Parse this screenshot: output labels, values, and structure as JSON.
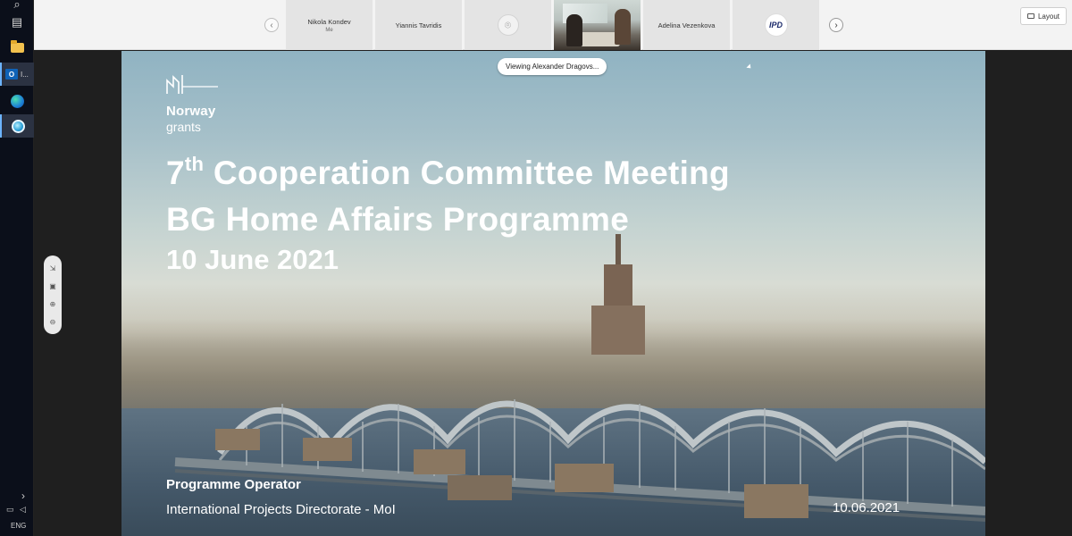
{
  "taskbar": {
    "language": "ENG",
    "outlook_badge": "I...",
    "show_more": "›"
  },
  "participants": [
    {
      "name": "Nikola Kondev",
      "sub": "Me"
    },
    {
      "name": "Yiannis Tavridis",
      "sub": ""
    },
    {
      "name": "",
      "sub": "",
      "type": "pin"
    },
    {
      "name": "",
      "sub": "",
      "type": "video"
    },
    {
      "name": "Adelina Vezenkova",
      "sub": ""
    },
    {
      "name": "IPD",
      "sub": "",
      "type": "logo"
    }
  ],
  "toolbar": {
    "layout_label": "Layout"
  },
  "screen_share": {
    "viewing_label": "Viewing Alexander Dragovs..."
  },
  "slide": {
    "brand_name": "Norway",
    "brand_sub": "grants",
    "title_line1_num": "7",
    "title_line1_sup": "th",
    "title_line1_rest": " Cooperation Committee Meeting",
    "title_line2": "BG Home Affairs Programme",
    "title_line3": "10 June 2021",
    "operator_label": "Programme Operator",
    "operator_value": "International Projects Directorate - MoI",
    "date": "10.06.2021"
  },
  "icons": {
    "search": "search-icon",
    "taskview": "task-view-icon",
    "explorer": "file-explorer-icon",
    "outlook": "outlook-icon",
    "edge": "edge-icon",
    "teams": "teams-icon"
  }
}
